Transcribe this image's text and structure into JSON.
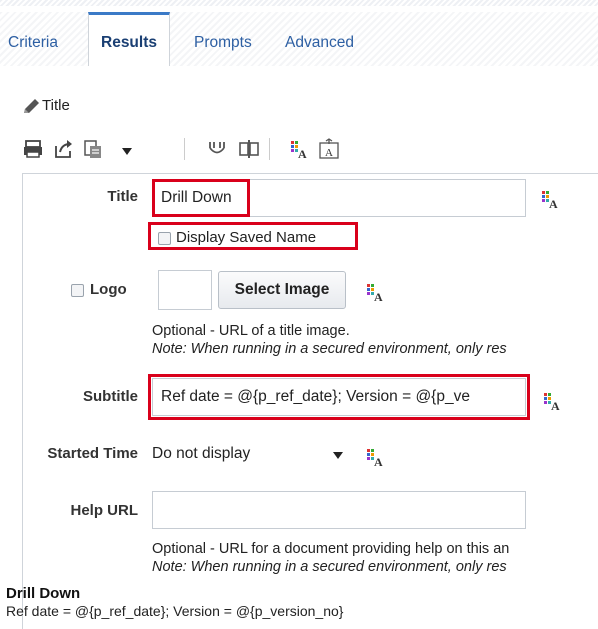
{
  "tabs": [
    {
      "label": "Criteria"
    },
    {
      "label": "Results"
    },
    {
      "label": "Prompts"
    },
    {
      "label": "Advanced"
    }
  ],
  "active_tab": "Results",
  "section": {
    "title": "Title"
  },
  "form": {
    "title_label": "Title",
    "title_value": "Drill Down",
    "display_saved_name_label": "Display Saved Name",
    "logo_label": "Logo",
    "select_image_label": "Select Image",
    "logo_note": "Optional - URL of a title image.",
    "logo_note_italic": "Note: When running in a secured environment, only res",
    "subtitle_label": "Subtitle",
    "subtitle_value": "Ref date = @{p_ref_date}; Version = @{p_ve",
    "started_time_label": "Started Time",
    "started_time_value": "Do not display",
    "help_url_label": "Help URL",
    "help_url_value": "",
    "help_note": "Optional - URL for a document providing help on this an",
    "help_note_italic": "Note: When running in a secured environment, only res"
  },
  "preview": {
    "title": "Drill Down",
    "subtitle": "Ref date = @{p_ref_date}; Version = @{p_version_no}"
  },
  "icons": {
    "print": "print-icon",
    "export": "export-icon",
    "paste": "paste-icon",
    "view1": "view-icon",
    "view2": "split-icon",
    "format_text": "format-text-icon",
    "format_title": "format-title-icon"
  },
  "colors": {
    "highlight": "#d9001b",
    "tab_active_border": "#3b7ac7"
  }
}
